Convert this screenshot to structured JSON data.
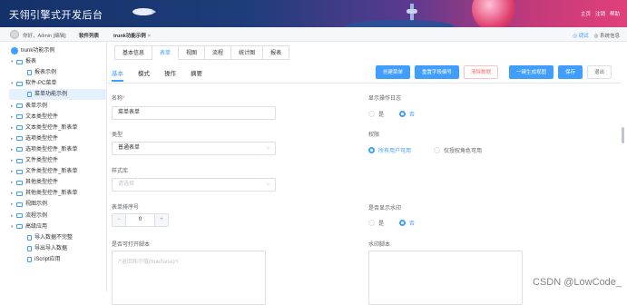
{
  "header": {
    "title": "天翎引擎式开发后台",
    "menu": [
      "主页",
      "注销",
      "帮助"
    ]
  },
  "crumbs": {
    "greeting": "你好，Admin [编辑]",
    "item1": "软件列表",
    "item2": "trunk功能示例",
    "item2_close": "×",
    "right": [
      "◎ 调试",
      "◎ 系统信息"
    ]
  },
  "sidebar": {
    "items": [
      {
        "label": "trunk功能示例",
        "level": 0,
        "kind": "home",
        "arrow": ""
      },
      {
        "label": "报表",
        "level": 1,
        "kind": "folder",
        "arrow": "▾"
      },
      {
        "label": "报表示例",
        "level": 2,
        "kind": "file",
        "arrow": ""
      },
      {
        "label": "软件-PC菜单",
        "level": 1,
        "kind": "folder",
        "arrow": "▾"
      },
      {
        "label": "菜单功能示例",
        "level": 2,
        "kind": "file",
        "arrow": "",
        "selected": true
      },
      {
        "label": "表单示例",
        "level": 1,
        "kind": "folder",
        "arrow": "▸"
      },
      {
        "label": "文本类型控件",
        "level": 1,
        "kind": "folder",
        "arrow": "▸"
      },
      {
        "label": "文本类型控件_新表单",
        "level": 1,
        "kind": "folder",
        "arrow": "▸"
      },
      {
        "label": "选项类型控件",
        "level": 1,
        "kind": "folder",
        "arrow": "▸"
      },
      {
        "label": "选项类型控件_新表单",
        "level": 1,
        "kind": "folder",
        "arrow": "▸"
      },
      {
        "label": "文件类型控件",
        "level": 1,
        "kind": "folder",
        "arrow": "▸"
      },
      {
        "label": "文件类型控件_新表单",
        "level": 1,
        "kind": "folder",
        "arrow": "▸"
      },
      {
        "label": "其他类型控件",
        "level": 1,
        "kind": "folder",
        "arrow": "▸"
      },
      {
        "label": "其他类型控件_新表单",
        "level": 1,
        "kind": "folder",
        "arrow": "▸"
      },
      {
        "label": "视图示例",
        "level": 1,
        "kind": "folder",
        "arrow": "▸"
      },
      {
        "label": "流程示例",
        "level": 1,
        "kind": "folder",
        "arrow": "▸"
      },
      {
        "label": "高级应用",
        "level": 1,
        "kind": "folder",
        "arrow": "▾"
      },
      {
        "label": "导入数据不完整",
        "level": 2,
        "kind": "file",
        "arrow": ""
      },
      {
        "label": "导出导入数据",
        "level": 2,
        "kind": "file",
        "arrow": ""
      },
      {
        "label": "iScript应用",
        "level": 2,
        "kind": "file",
        "arrow": ""
      }
    ]
  },
  "top_tabs": [
    "基本信息",
    "表单",
    "视图",
    "流程",
    "统计图",
    "报表"
  ],
  "top_tab_active": 1,
  "sub_tabs": [
    "基本",
    "模式",
    "操作",
    "摘要"
  ],
  "buttons": {
    "create_menu": "创建菜单",
    "reset_num": "重置字段编号",
    "clear_data": "清除数据",
    "gen_view": "一键生成视图",
    "save": "保存",
    "exit": "退出"
  },
  "form": {
    "name_label": "名称",
    "name_required": "*",
    "name_value": "菜单表单",
    "type_label": "类型",
    "type_value": "普通表单",
    "style_label": "样式库",
    "style_placeholder": "请选择",
    "order_label": "表单排序号",
    "order_value": "0",
    "minus": "−",
    "plus": "+",
    "print_label": "是否可打开脚本",
    "print_placeholder": "/*返回布尔值(true/false)*/",
    "log_label": "显示操作日志",
    "log_yes": "是",
    "log_no": "否",
    "log_selected": "否",
    "perm_label": "权限",
    "perm_all": "所有用户可用",
    "perm_role": "仅授权角色可用",
    "perm_selected": "所有用户可用",
    "wm_label": "是否显示水印",
    "wm_yes": "是",
    "wm_no": "否",
    "wm_selected": "否",
    "wmscript_label": "水印脚本"
  },
  "watermark": "CSDN @LowCode_",
  "colors": {
    "primary": "#409eff",
    "danger": "#f56c6c"
  }
}
